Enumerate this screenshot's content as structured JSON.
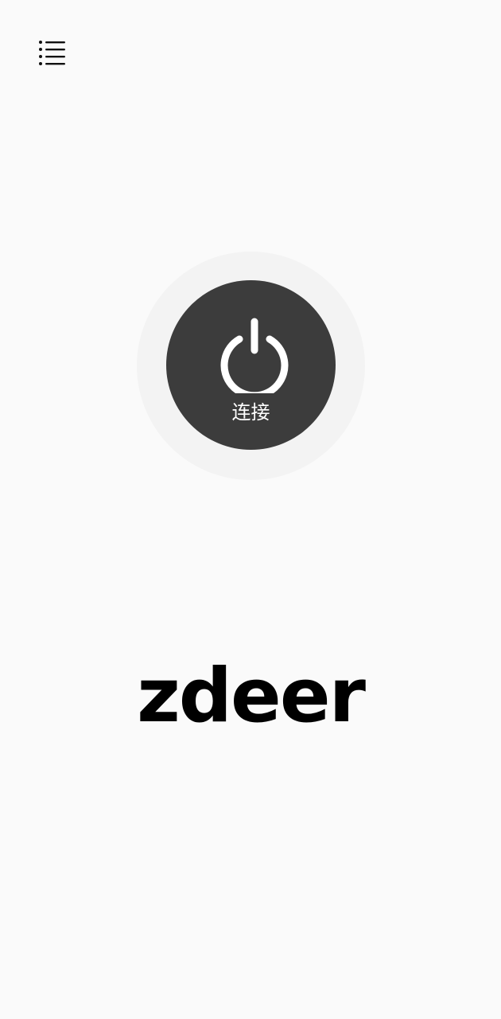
{
  "header": {
    "menu_icon": "menu-list-icon"
  },
  "power": {
    "icon": "power-icon",
    "label": "连接",
    "button_color": "#3c3c3c",
    "halo_color": "#f3f3f3"
  },
  "brand": {
    "name": "zdeer"
  }
}
